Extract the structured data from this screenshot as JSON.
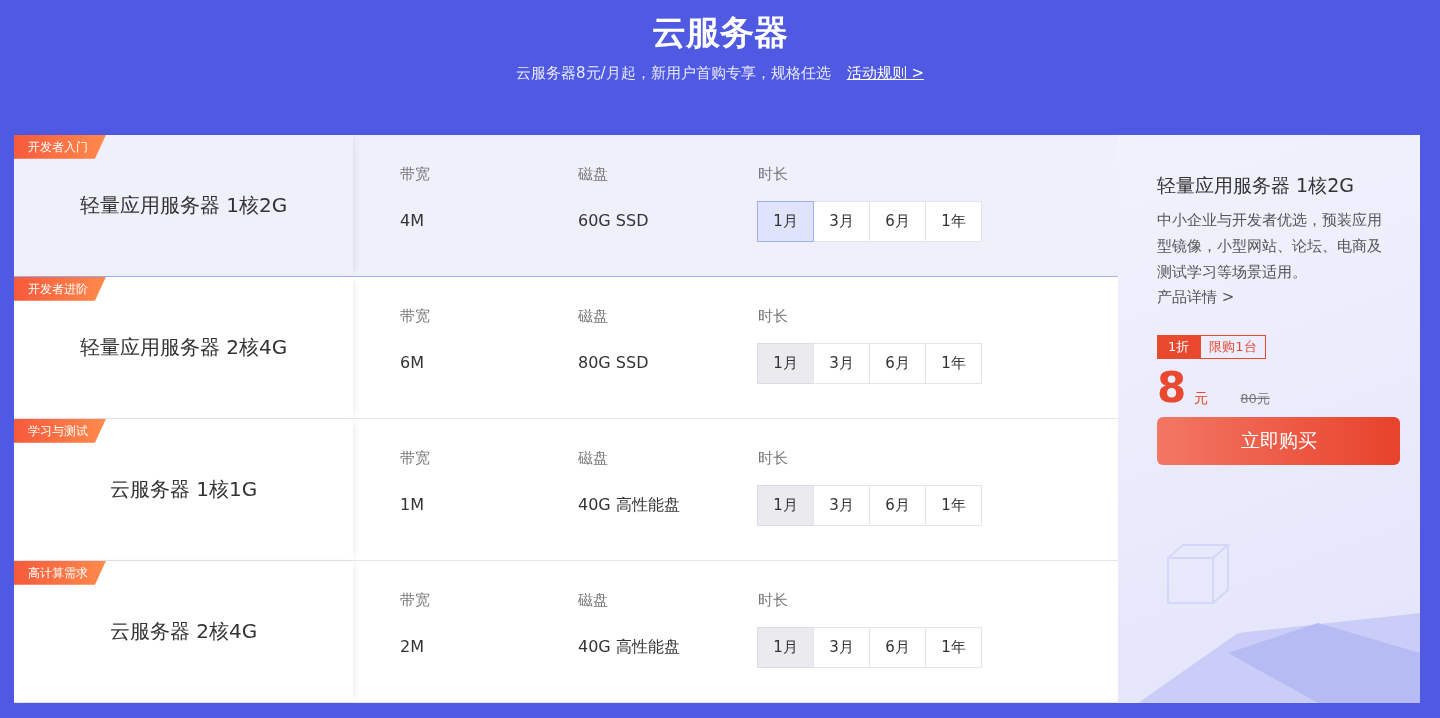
{
  "header": {
    "title": "云服务器",
    "subtitle": "云服务器8元/月起，新用户首购专享，规格任选",
    "rules_link": "活动规则 >"
  },
  "products": [
    {
      "tag": "开发者入门",
      "name": "轻量应用服务器 1核2G",
      "bandwidth_label": "带宽",
      "bandwidth": "4M",
      "disk_label": "磁盘",
      "disk": "60G SSD",
      "duration_label": "时长",
      "selected": true,
      "durations": [
        {
          "label": "1月",
          "selected": true
        },
        {
          "label": "3月",
          "selected": false
        },
        {
          "label": "6月",
          "selected": false
        },
        {
          "label": "1年",
          "selected": false
        }
      ]
    },
    {
      "tag": "开发者进阶",
      "name": "轻量应用服务器 2核4G",
      "bandwidth_label": "带宽",
      "bandwidth": "6M",
      "disk_label": "磁盘",
      "disk": "80G SSD",
      "duration_label": "时长",
      "selected": false,
      "durations": [
        {
          "label": "1月",
          "selected": true
        },
        {
          "label": "3月",
          "selected": false
        },
        {
          "label": "6月",
          "selected": false
        },
        {
          "label": "1年",
          "selected": false
        }
      ]
    },
    {
      "tag": "学习与测试",
      "name": "云服务器 1核1G",
      "bandwidth_label": "带宽",
      "bandwidth": "1M",
      "disk_label": "磁盘",
      "disk": "40G 高性能盘",
      "duration_label": "时长",
      "selected": false,
      "durations": [
        {
          "label": "1月",
          "selected": true
        },
        {
          "label": "3月",
          "selected": false
        },
        {
          "label": "6月",
          "selected": false
        },
        {
          "label": "1年",
          "selected": false
        }
      ]
    },
    {
      "tag": "高计算需求",
      "name": "云服务器 2核4G",
      "bandwidth_label": "带宽",
      "bandwidth": "2M",
      "disk_label": "磁盘",
      "disk": "40G 高性能盘",
      "duration_label": "时长",
      "selected": false,
      "durations": [
        {
          "label": "1月",
          "selected": true
        },
        {
          "label": "3月",
          "selected": false
        },
        {
          "label": "6月",
          "selected": false
        },
        {
          "label": "1年",
          "selected": false
        }
      ]
    }
  ],
  "detail": {
    "title": "轻量应用服务器 1核2G",
    "description": "中小企业与开发者优选，预装应用型镜像，小型网站、论坛、电商及测试学习等场景适用。",
    "details_link": "产品详情 >",
    "discount": "1折",
    "limit": "限购1台",
    "price": "8",
    "unit": "元",
    "original_price": "80元",
    "buy_button": "立即购买"
  }
}
